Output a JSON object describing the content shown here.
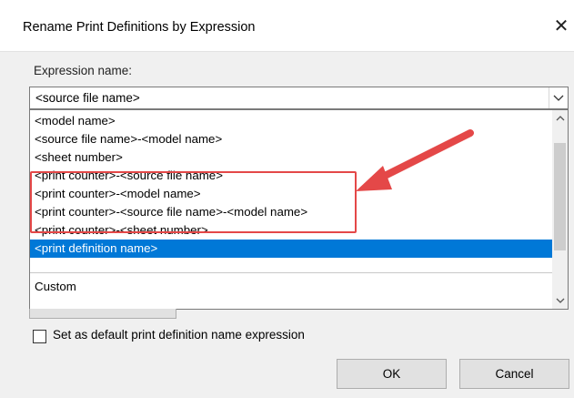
{
  "dialog": {
    "title": "Rename Print Definitions by Expression",
    "close_glyph": "✕"
  },
  "expression": {
    "label": "Expression name:",
    "selected_value": "<source file name>"
  },
  "dropdown": {
    "options": [
      "<model name>",
      "<source file name>-<model name>",
      "<sheet number>",
      "<print counter>-<source file name>",
      "<print counter>-<model name>",
      "<print counter>-<source file name>-<model name>",
      "<print counter>-<sheet number>",
      "<print definition name>",
      "Custom"
    ],
    "selected_index": 7,
    "highlighted_range": [
      3,
      5
    ]
  },
  "options": {
    "default_checkbox_label": "Set as default print definition name expression",
    "default_checked": false
  },
  "buttons": {
    "ok": "OK",
    "cancel": "Cancel"
  },
  "icons": {
    "close": "close-icon",
    "combo_arrow": "chevron-down-icon",
    "scroll_up": "chevron-up-icon",
    "scroll_down": "chevron-down-icon",
    "annotation_arrow": "red-arrow-icon"
  },
  "colors": {
    "selection": "#0078d7",
    "annotation": "#e44848",
    "dialog_bg": "#f0f0f0"
  }
}
